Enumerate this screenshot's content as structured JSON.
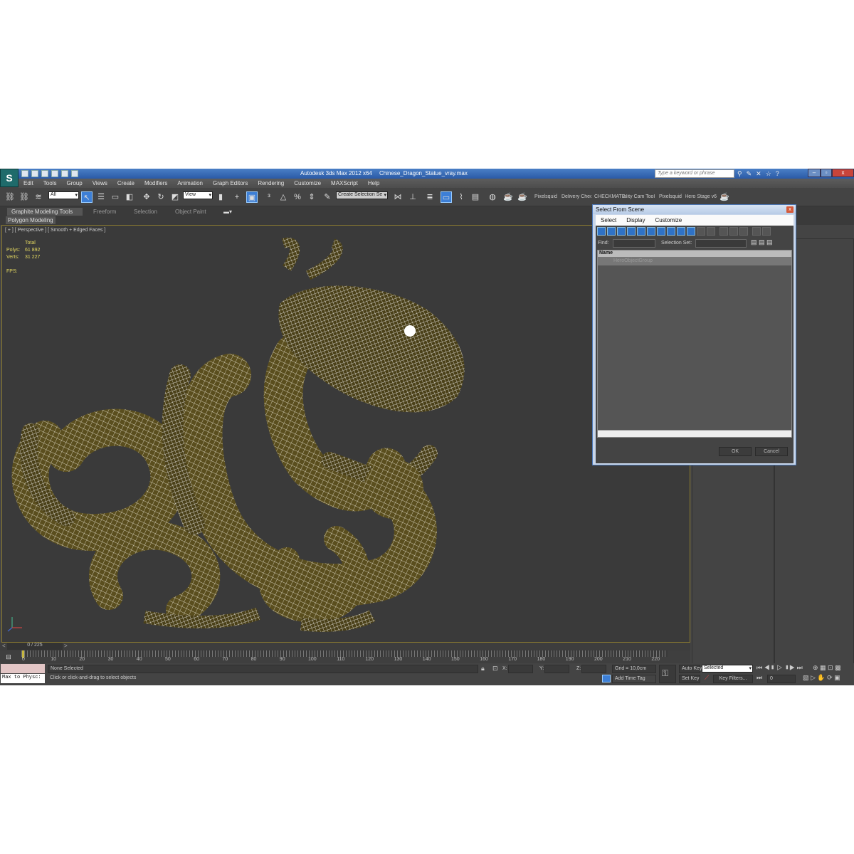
{
  "title": {
    "app": "Autodesk 3ds Max  2012 x64",
    "file": "Chinese_Dragon_Statue_vray.max",
    "search_placeholder": "Type a keyword or phrase"
  },
  "menu": [
    "Edit",
    "Tools",
    "Group",
    "Views",
    "Create",
    "Modifiers",
    "Animation",
    "Graph Editors",
    "Rendering",
    "Customize",
    "MAXScript",
    "Help"
  ],
  "toolbar": {
    "filter": "All",
    "ref_coord": "View",
    "selection_set": "Create Selection Se",
    "plugins": [
      "Pixelsquid",
      "Delivery Check",
      "CHECKMATE",
      "Quality Cam Tool",
      "Pixelsquid",
      "Hero Stage v6"
    ]
  },
  "ribbon": {
    "tabs": [
      "Graphite Modeling Tools",
      "Freeform",
      "Selection",
      "Object Paint"
    ],
    "sub": "Polygon Modeling"
  },
  "viewport": {
    "label": "[ + ] [ Perspective ] [ Smooth + Edged Faces ]",
    "stats": {
      "total": "Total",
      "polys_label": "Polys:",
      "polys": "61 892",
      "verts_label": "Verts:",
      "verts": "31 227",
      "fps_label": "FPS:"
    },
    "mesh_color": "#5a4e1e",
    "wire_color": "#ffffff"
  },
  "dialog": {
    "title": "Select From Scene",
    "menu": [
      "Select",
      "Display",
      "Customize"
    ],
    "find_label": "Find:",
    "selset_label": "Selection Set:",
    "column": "Name",
    "items": [
      "HeroObjectGroup"
    ],
    "ok": "OK",
    "cancel": "Cancel"
  },
  "timeline": {
    "frame": "0 / 225",
    "ticks": [
      "0",
      "10",
      "20",
      "30",
      "40",
      "50",
      "60",
      "70",
      "80",
      "90",
      "100",
      "110",
      "120",
      "130",
      "140",
      "150",
      "160",
      "170",
      "180",
      "190",
      "200",
      "210",
      "220"
    ]
  },
  "status": {
    "maxscript": "Max to Physc:",
    "selection": "None Selected",
    "prompt": "Click or click-and-drag to select objects",
    "x": "X:",
    "y": "Y:",
    "z": "Z:",
    "grid": "Grid = 10,0cm",
    "add_time_tag": "Add Time Tag",
    "auto_key": "Auto Key",
    "set_key": "Set Key",
    "key_mode": "Selected",
    "key_filters": "Key Filters...",
    "frame_value": "0"
  }
}
